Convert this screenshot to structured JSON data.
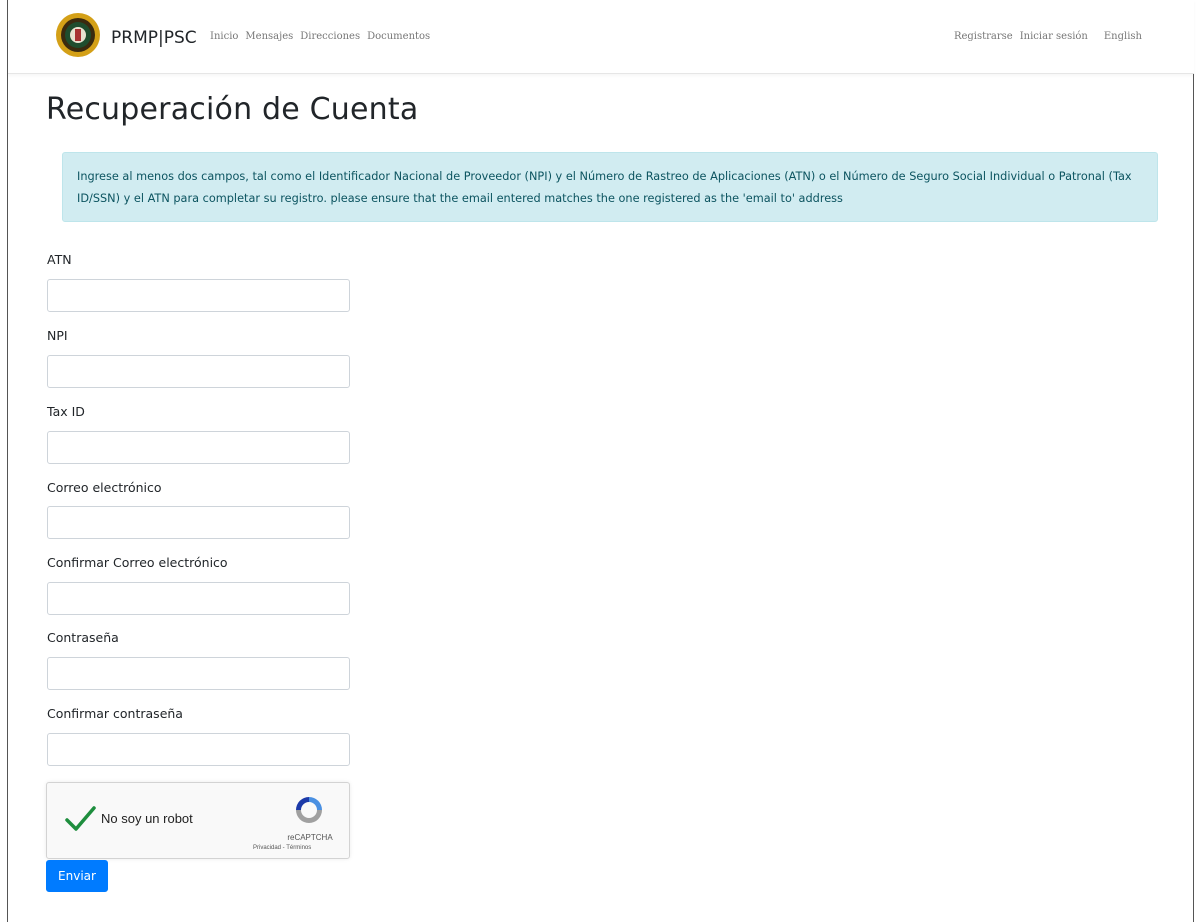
{
  "header": {
    "brand": "PRMP|PSC",
    "nav_left": [
      "Inicio",
      "Mensajes",
      "Direcciones",
      "Documentos"
    ],
    "nav_right": [
      "Registrarse",
      "Iniciar sesión",
      "English"
    ]
  },
  "page": {
    "title": "Recuperación de Cuenta",
    "info": "Ingrese al menos dos campos, tal como el Identificador Nacional de Proveedor (NPI) y el Número de Rastreo de Aplicaciones (ATN) o el Número de Seguro Social Individual o Patronal (Tax ID/SSN) y el ATN para completar su registro. please ensure that the email entered matches the one registered as the 'email to' address"
  },
  "form": {
    "atn_label": "ATN",
    "atn_value": "",
    "npi_label": "NPI",
    "npi_value": "",
    "taxid_label": "Tax ID",
    "taxid_value": "",
    "email_label": "Correo electrónico",
    "email_value": "",
    "confirm_email_label": "Confirmar Correo electrónico",
    "confirm_email_value": "",
    "password_label": "Contraseña",
    "password_value": "",
    "confirm_password_label": "Confirmar contraseña",
    "confirm_password_value": "",
    "submit_label": "Enviar"
  },
  "captcha": {
    "label": "No soy un robot",
    "brand": "reCAPTCHA",
    "privacy": "Privacidad - Términos",
    "checked": true
  },
  "colors": {
    "primary": "#007bff",
    "alert_bg": "#d1ecf1",
    "alert_text": "#0c5460",
    "check_green": "#1e8e3e"
  }
}
